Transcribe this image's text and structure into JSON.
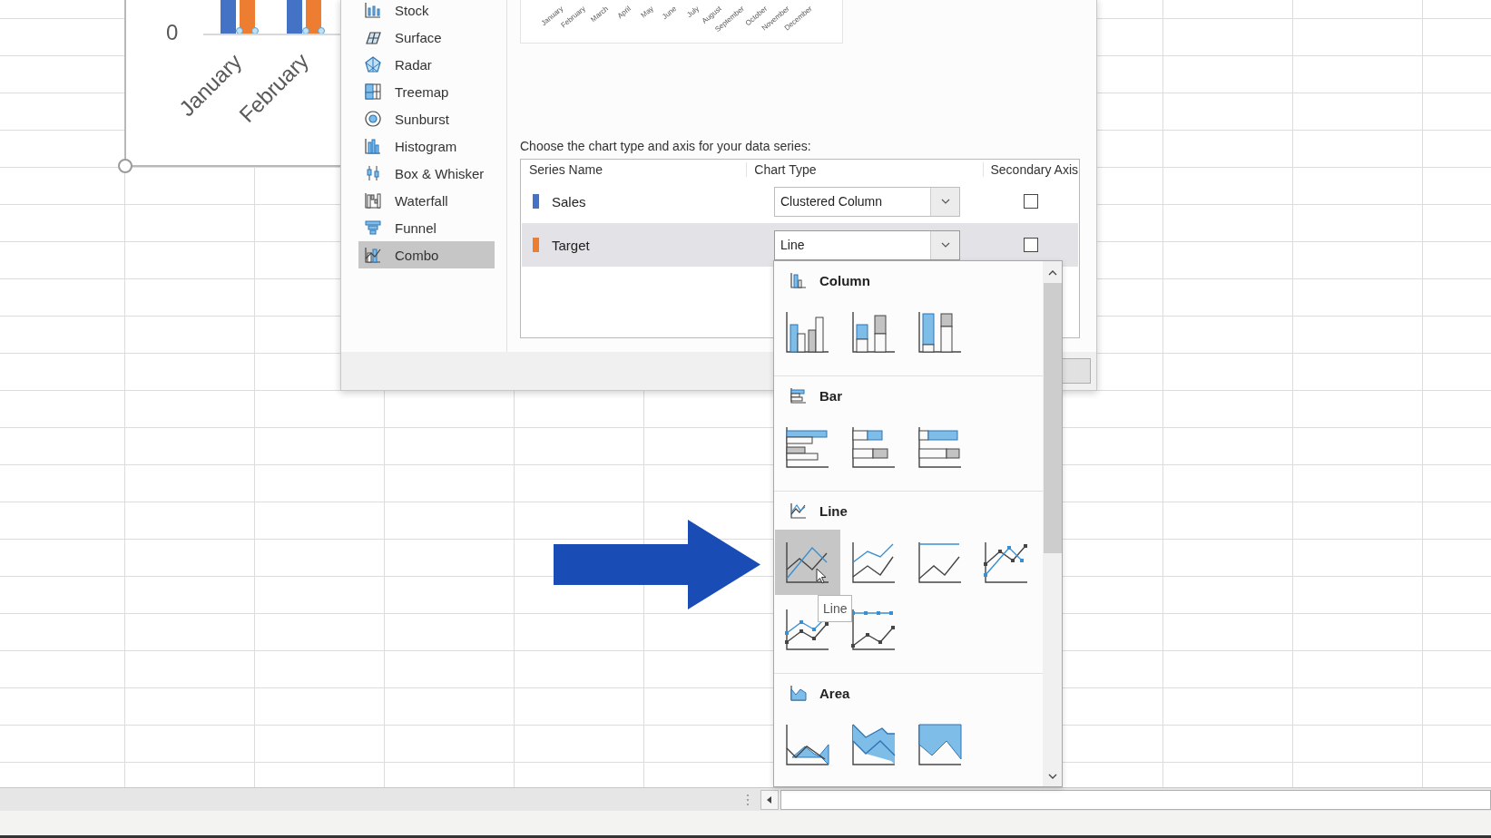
{
  "chart_object": {
    "axis_label": "0",
    "categories": [
      "January",
      "February"
    ]
  },
  "dialog": {
    "chart_types": [
      {
        "label": "Stock",
        "kind": "stock",
        "selected": false
      },
      {
        "label": "Surface",
        "kind": "surface",
        "selected": false
      },
      {
        "label": "Radar",
        "kind": "radar",
        "selected": false
      },
      {
        "label": "Treemap",
        "kind": "treemap",
        "selected": false
      },
      {
        "label": "Sunburst",
        "kind": "sunburst",
        "selected": false
      },
      {
        "label": "Histogram",
        "kind": "histogram",
        "selected": false
      },
      {
        "label": "Box & Whisker",
        "kind": "box-whisker",
        "selected": false
      },
      {
        "label": "Waterfall",
        "kind": "waterfall",
        "selected": false
      },
      {
        "label": "Funnel",
        "kind": "funnel",
        "selected": false
      },
      {
        "label": "Combo",
        "kind": "combo",
        "selected": true
      }
    ],
    "preview": {
      "categories": [
        "January",
        "February",
        "March",
        "April",
        "May",
        "June",
        "July",
        "August",
        "September",
        "October",
        "November",
        "December"
      ]
    },
    "instruction": "Choose the chart type and axis for your data series:",
    "series_table": {
      "columns": [
        "Series Name",
        "Chart Type",
        "Secondary Axis"
      ],
      "rows": [
        {
          "name": "Sales",
          "color": "#4472c4",
          "chart_type": "Clustered Column",
          "secondary_axis": false,
          "selected": false,
          "open": false
        },
        {
          "name": "Target",
          "color": "#ed7d31",
          "chart_type": "Line",
          "secondary_axis": false,
          "selected": true,
          "open": true
        }
      ]
    }
  },
  "chart_type_menu": {
    "sections": [
      {
        "title": "Column",
        "kind": "column",
        "options": [
          {
            "kind": "clustered",
            "selected": false
          },
          {
            "kind": "stacked",
            "selected": false
          },
          {
            "kind": "percent",
            "selected": false
          }
        ]
      },
      {
        "title": "Bar",
        "kind": "bar",
        "options": [
          {
            "kind": "clustered",
            "selected": false
          },
          {
            "kind": "stacked",
            "selected": false
          },
          {
            "kind": "percent",
            "selected": false
          }
        ]
      },
      {
        "title": "Line",
        "kind": "line",
        "options": [
          {
            "kind": "plain",
            "selected": true
          },
          {
            "kind": "stacked",
            "selected": false
          },
          {
            "kind": "percent",
            "selected": false
          },
          {
            "kind": "markers",
            "selected": false
          },
          {
            "kind": "stacked-markers",
            "selected": false
          },
          {
            "kind": "percent-markers",
            "selected": false
          }
        ]
      },
      {
        "title": "Area",
        "kind": "area",
        "options": [
          {
            "kind": "plain",
            "selected": false
          },
          {
            "kind": "stacked",
            "selected": false
          },
          {
            "kind": "percent",
            "selected": false
          }
        ]
      }
    ]
  },
  "tooltip": "Line"
}
